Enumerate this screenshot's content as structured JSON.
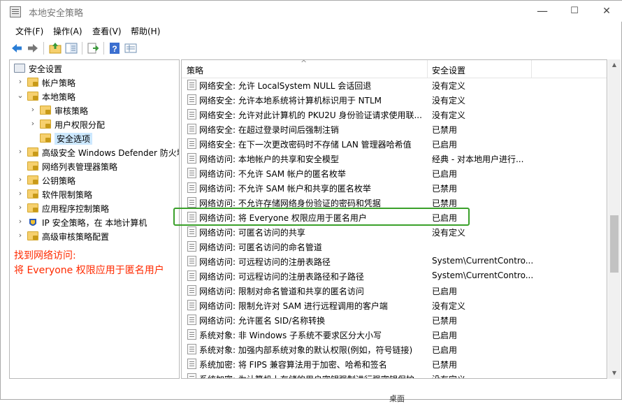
{
  "window": {
    "title": "本地安全策略",
    "minimize": "—",
    "maximize": "☐",
    "close": "✕"
  },
  "menu": [
    "文件(F)",
    "操作(A)",
    "查看(V)",
    "帮助(H)"
  ],
  "toolbar_icons": [
    "back-arrow-icon",
    "forward-arrow-icon",
    "up-folder-icon",
    "show-tree-icon",
    "export-list-icon",
    "help-icon",
    "properties-icon"
  ],
  "tree": [
    {
      "label": "安全设置",
      "level": 0,
      "expander": "",
      "icon": "security-root-icon"
    },
    {
      "label": "帐户策略",
      "level": 1,
      "expander": ">",
      "icon": "folder-icon"
    },
    {
      "label": "本地策略",
      "level": 1,
      "expander": "v",
      "icon": "folder-icon"
    },
    {
      "label": "审核策略",
      "level": 2,
      "expander": ">",
      "icon": "folder-icon"
    },
    {
      "label": "用户权限分配",
      "level": 2,
      "expander": ">",
      "icon": "folder-icon"
    },
    {
      "label": "安全选项",
      "level": 2,
      "expander": "",
      "icon": "folder-icon",
      "selected": true
    },
    {
      "label": "高级安全 Windows Defender 防火墙",
      "level": 1,
      "expander": ">",
      "icon": "folder-icon"
    },
    {
      "label": "网络列表管理器策略",
      "level": 1,
      "expander": "",
      "icon": "folder-icon"
    },
    {
      "label": "公钥策略",
      "level": 1,
      "expander": ">",
      "icon": "folder-icon"
    },
    {
      "label": "软件限制策略",
      "level": 1,
      "expander": ">",
      "icon": "folder-icon"
    },
    {
      "label": "应用程序控制策略",
      "level": 1,
      "expander": ">",
      "icon": "folder-icon"
    },
    {
      "label": "IP 安全策略，在 本地计算机",
      "level": 1,
      "expander": ">",
      "icon": "ip-security-icon"
    },
    {
      "label": "高级审核策略配置",
      "level": 1,
      "expander": ">",
      "icon": "folder-icon"
    }
  ],
  "annotation": {
    "line1": "找到网络访问:",
    "line2": "将 Everyone 权限应用于匿名用户",
    "color": "#ff2a00"
  },
  "columns": {
    "policy": "策略",
    "setting": "安全设置"
  },
  "highlight_color": "#3aa02a",
  "rows": [
    {
      "name": "网络安全: 允许 LocalSystem NULL 会话回退",
      "value": "没有定义"
    },
    {
      "name": "网络安全: 允许本地系统将计算机标识用于 NTLM",
      "value": "没有定义"
    },
    {
      "name": "网络安全: 允许对此计算机的 PKU2U 身份验证请求使用联...",
      "value": "没有定义"
    },
    {
      "name": "网络安全: 在超过登录时间后强制注销",
      "value": "已禁用"
    },
    {
      "name": "网络安全: 在下一次更改密码时不存储 LAN 管理器哈希值",
      "value": "已启用"
    },
    {
      "name": "网络访问: 本地帐户的共享和安全模型",
      "value": "经典 - 对本地用户进行..."
    },
    {
      "name": "网络访问: 不允许 SAM 帐户的匿名枚举",
      "value": "已启用"
    },
    {
      "name": "网络访问: 不允许 SAM 帐户和共享的匿名枚举",
      "value": "已禁用"
    },
    {
      "name": "网络访问: 不允许存储网络身份验证的密码和凭据",
      "value": "已禁用"
    },
    {
      "name": "网络访问: 将 Everyone 权限应用于匿名用户",
      "value": "已启用",
      "highlight": true
    },
    {
      "name": "网络访问: 可匿名访问的共享",
      "value": "没有定义"
    },
    {
      "name": "网络访问: 可匿名访问的命名管道",
      "value": ""
    },
    {
      "name": "网络访问: 可远程访问的注册表路径",
      "value": "System\\CurrentContro..."
    },
    {
      "name": "网络访问: 可远程访问的注册表路径和子路径",
      "value": "System\\CurrentContro..."
    },
    {
      "name": "网络访问: 限制对命名管道和共享的匿名访问",
      "value": "已启用"
    },
    {
      "name": "网络访问: 限制允许对 SAM 进行远程调用的客户端",
      "value": "没有定义"
    },
    {
      "name": "网络访问: 允许匿名 SID/名称转换",
      "value": "已禁用"
    },
    {
      "name": "系统对象: 非 Windows 子系统不要求区分大小写",
      "value": "已启用"
    },
    {
      "name": "系统对象: 加强内部系统对象的默认权限(例如，符号链接)",
      "value": "已启用"
    },
    {
      "name": "系统加密: 将 FIPS 兼容算法用于加密、哈希和签名",
      "value": "已禁用"
    },
    {
      "name": "系统加密: 为计算机上存储的用户密钥强制进行强密钥保护",
      "value": "没有定义"
    }
  ],
  "peek_text": "桌面"
}
